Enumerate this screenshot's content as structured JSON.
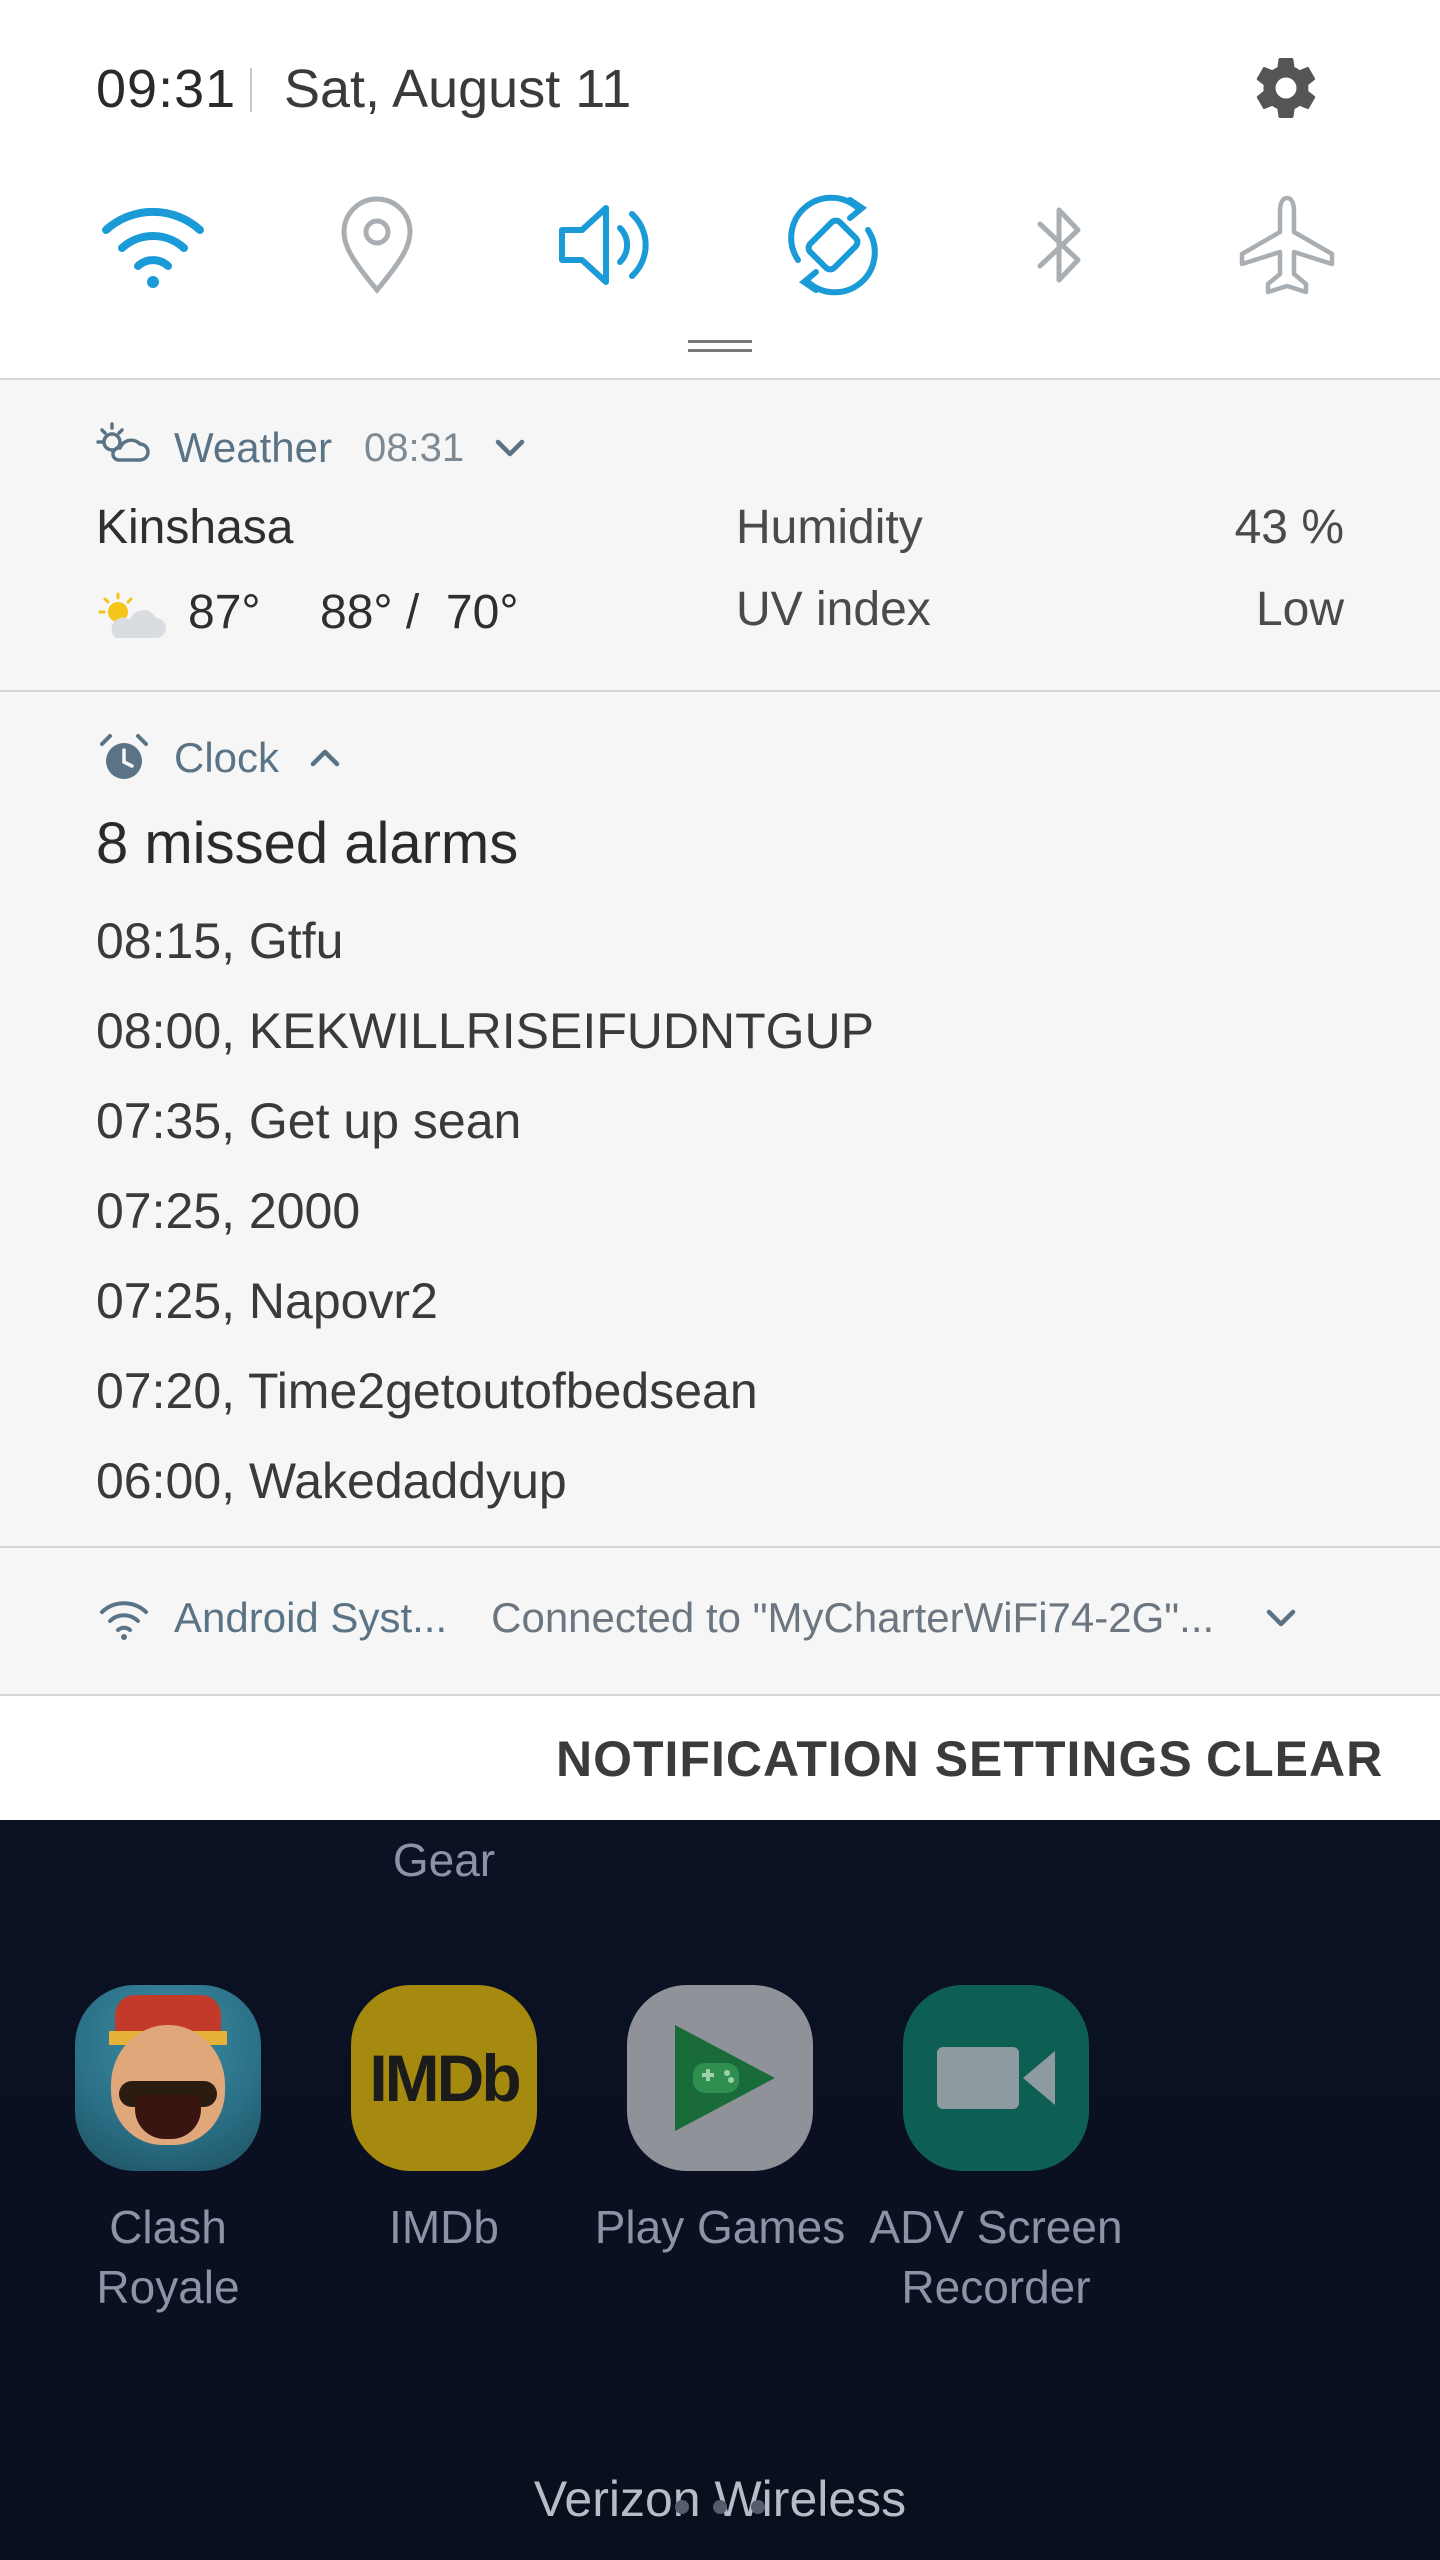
{
  "status": {
    "time": "09:31",
    "date": "Sat, August 11"
  },
  "quick_settings": {
    "tiles": [
      {
        "name": "wifi",
        "state": "on"
      },
      {
        "name": "location",
        "state": "off"
      },
      {
        "name": "sound",
        "state": "on"
      },
      {
        "name": "auto-rotate",
        "state": "on"
      },
      {
        "name": "bluetooth",
        "state": "off"
      },
      {
        "name": "airplane-mode",
        "state": "off"
      }
    ],
    "accent_color": "#1b9ad8",
    "inactive_color": "#a9aeb3"
  },
  "weather": {
    "app": "Weather",
    "time": "08:31",
    "city": "Kinshasa",
    "temp": "87°",
    "hi_lo": "88° /  70°",
    "humidity_label": "Humidity",
    "humidity_value": "43 %",
    "uv_label": "UV index",
    "uv_value": "Low"
  },
  "clock": {
    "app": "Clock",
    "title": "8 missed alarms",
    "alarms": [
      "08:15, Gtfu",
      "08:00, KEKWILLRISEIFUDNTGUP",
      "07:35, Get up sean",
      "07:25, 2000",
      "07:25, Napovr2",
      "07:20, Time2getoutofbedsean",
      "06:00, Wakedaddyup"
    ]
  },
  "system": {
    "app": "Android Syst...",
    "message": "Connected to \"MyCharterWiFi74-2G\"..."
  },
  "actions": {
    "settings": "NOTIFICATION SETTINGS",
    "clear": "CLEAR"
  },
  "home": {
    "gear_label": "Gear",
    "apps": [
      {
        "label_1": "Clash",
        "label_2": "Royale"
      },
      {
        "label_1": "IMDb",
        "label_2": ""
      },
      {
        "label_1": "Play Games",
        "label_2": ""
      },
      {
        "label_1": "ADV Screen",
        "label_2": "Recorder"
      }
    ],
    "imdb_logo": "IMDb",
    "carrier": "Verizon Wireless"
  }
}
